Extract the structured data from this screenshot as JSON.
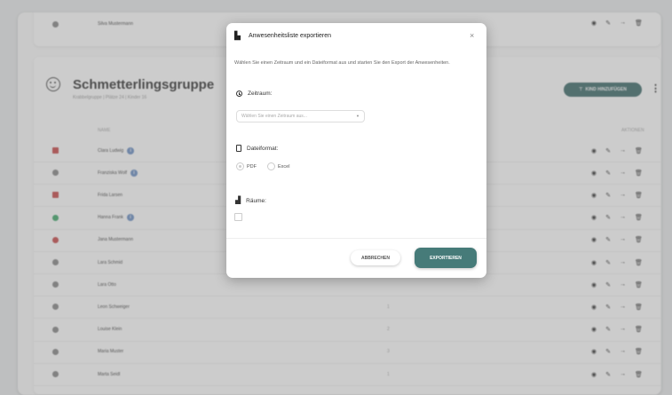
{
  "top_row": {
    "name": "Silva Mustermann"
  },
  "group": {
    "title": "Schmetterlingsgruppe",
    "subtitle": "Krabbelgruppe  |  Plätze 24  |  Kinder 16",
    "add_button": "KIND HINZUFÜGEN",
    "col_name": "NAME",
    "col_actions": "AKTIONEN"
  },
  "rows": [
    {
      "name": "Clara Ludwig",
      "mid": "",
      "status_color": "#c84a4a",
      "status_shape": "square",
      "info": true
    },
    {
      "name": "Franziska Wolf",
      "mid": "",
      "status_color": "#888888",
      "status_shape": "circle",
      "info": true
    },
    {
      "name": "Frida Larsen",
      "mid": "",
      "status_color": "#c84a4a",
      "status_shape": "square",
      "info": false
    },
    {
      "name": "Hanna Frank",
      "mid": "",
      "status_color": "#3fa86a",
      "status_shape": "circle",
      "info": true
    },
    {
      "name": "Jana Mustermann",
      "mid": "",
      "status_color": "#c84a4a",
      "status_shape": "circle",
      "info": false
    },
    {
      "name": "Lara Schmid",
      "mid": "",
      "status_color": "#888888",
      "status_shape": "circle",
      "info": false
    },
    {
      "name": "Lara Otto",
      "mid": "",
      "status_color": "#888888",
      "status_shape": "circle",
      "info": false
    },
    {
      "name": "Leon Schweiger",
      "mid": "1",
      "status_color": "#888888",
      "status_shape": "circle",
      "info": false
    },
    {
      "name": "Louise Klein",
      "mid": "2",
      "status_color": "#888888",
      "status_shape": "circle",
      "info": false
    },
    {
      "name": "Maria Muster",
      "mid": "3",
      "status_color": "#888888",
      "status_shape": "circle",
      "info": false
    },
    {
      "name": "Marta Seidl",
      "mid": "1",
      "status_color": "#888888",
      "status_shape": "circle",
      "info": false
    }
  ],
  "modal": {
    "title": "Anwesenheitsliste exportieren",
    "close": "×",
    "intro": "Wählen Sie einen Zeitraum und ein Dateiformat aus und starten Sie den Export der Anwesenheiten.",
    "zeitraum_label": "Zeitraum:",
    "zeitraum_placeholder": "Wählen Sie einen Zeitraum aus...",
    "dateiformat_label": "Dateiformat:",
    "format_options": [
      "PDF",
      "Excel"
    ],
    "format_selected": "PDF",
    "raeume_label": "Räume:",
    "cancel_label": "ABBRECHEN",
    "export_label": "EXPORTIEREN"
  },
  "colors": {
    "accent": "#467b79",
    "overlay": "rgba(120,120,120,0.38)"
  }
}
